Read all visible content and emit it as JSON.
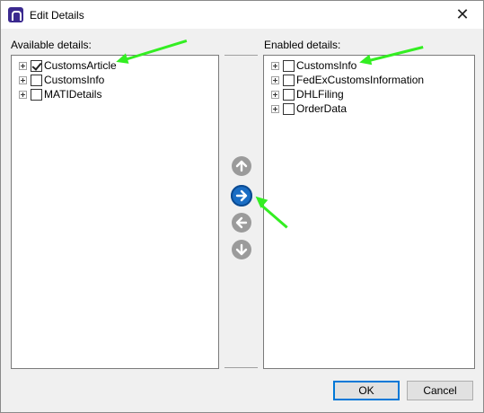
{
  "window": {
    "title": "Edit Details",
    "close_symbol": "✕"
  },
  "available": {
    "label": "Available details:",
    "items": [
      {
        "label": "CustomsArticle",
        "checked": true
      },
      {
        "label": "CustomsInfo",
        "checked": false
      },
      {
        "label": "MATIDetails",
        "checked": false
      }
    ]
  },
  "enabled": {
    "label": "Enabled details:",
    "items": [
      {
        "label": "CustomsInfo",
        "checked": false
      },
      {
        "label": "FedExCustomsInformation",
        "checked": false
      },
      {
        "label": "DHLFiling",
        "checked": false
      },
      {
        "label": "OrderData",
        "checked": false
      }
    ]
  },
  "buttons": {
    "ok": "OK",
    "cancel": "Cancel"
  },
  "colors": {
    "annotation": "#33ee22",
    "accent": "#1a6dc4",
    "disabled": "#9b9b9b"
  },
  "icons": [
    "app-logo-icon",
    "close-icon",
    "arrow-up-icon",
    "arrow-right-icon",
    "arrow-left-icon",
    "arrow-down-icon"
  ]
}
